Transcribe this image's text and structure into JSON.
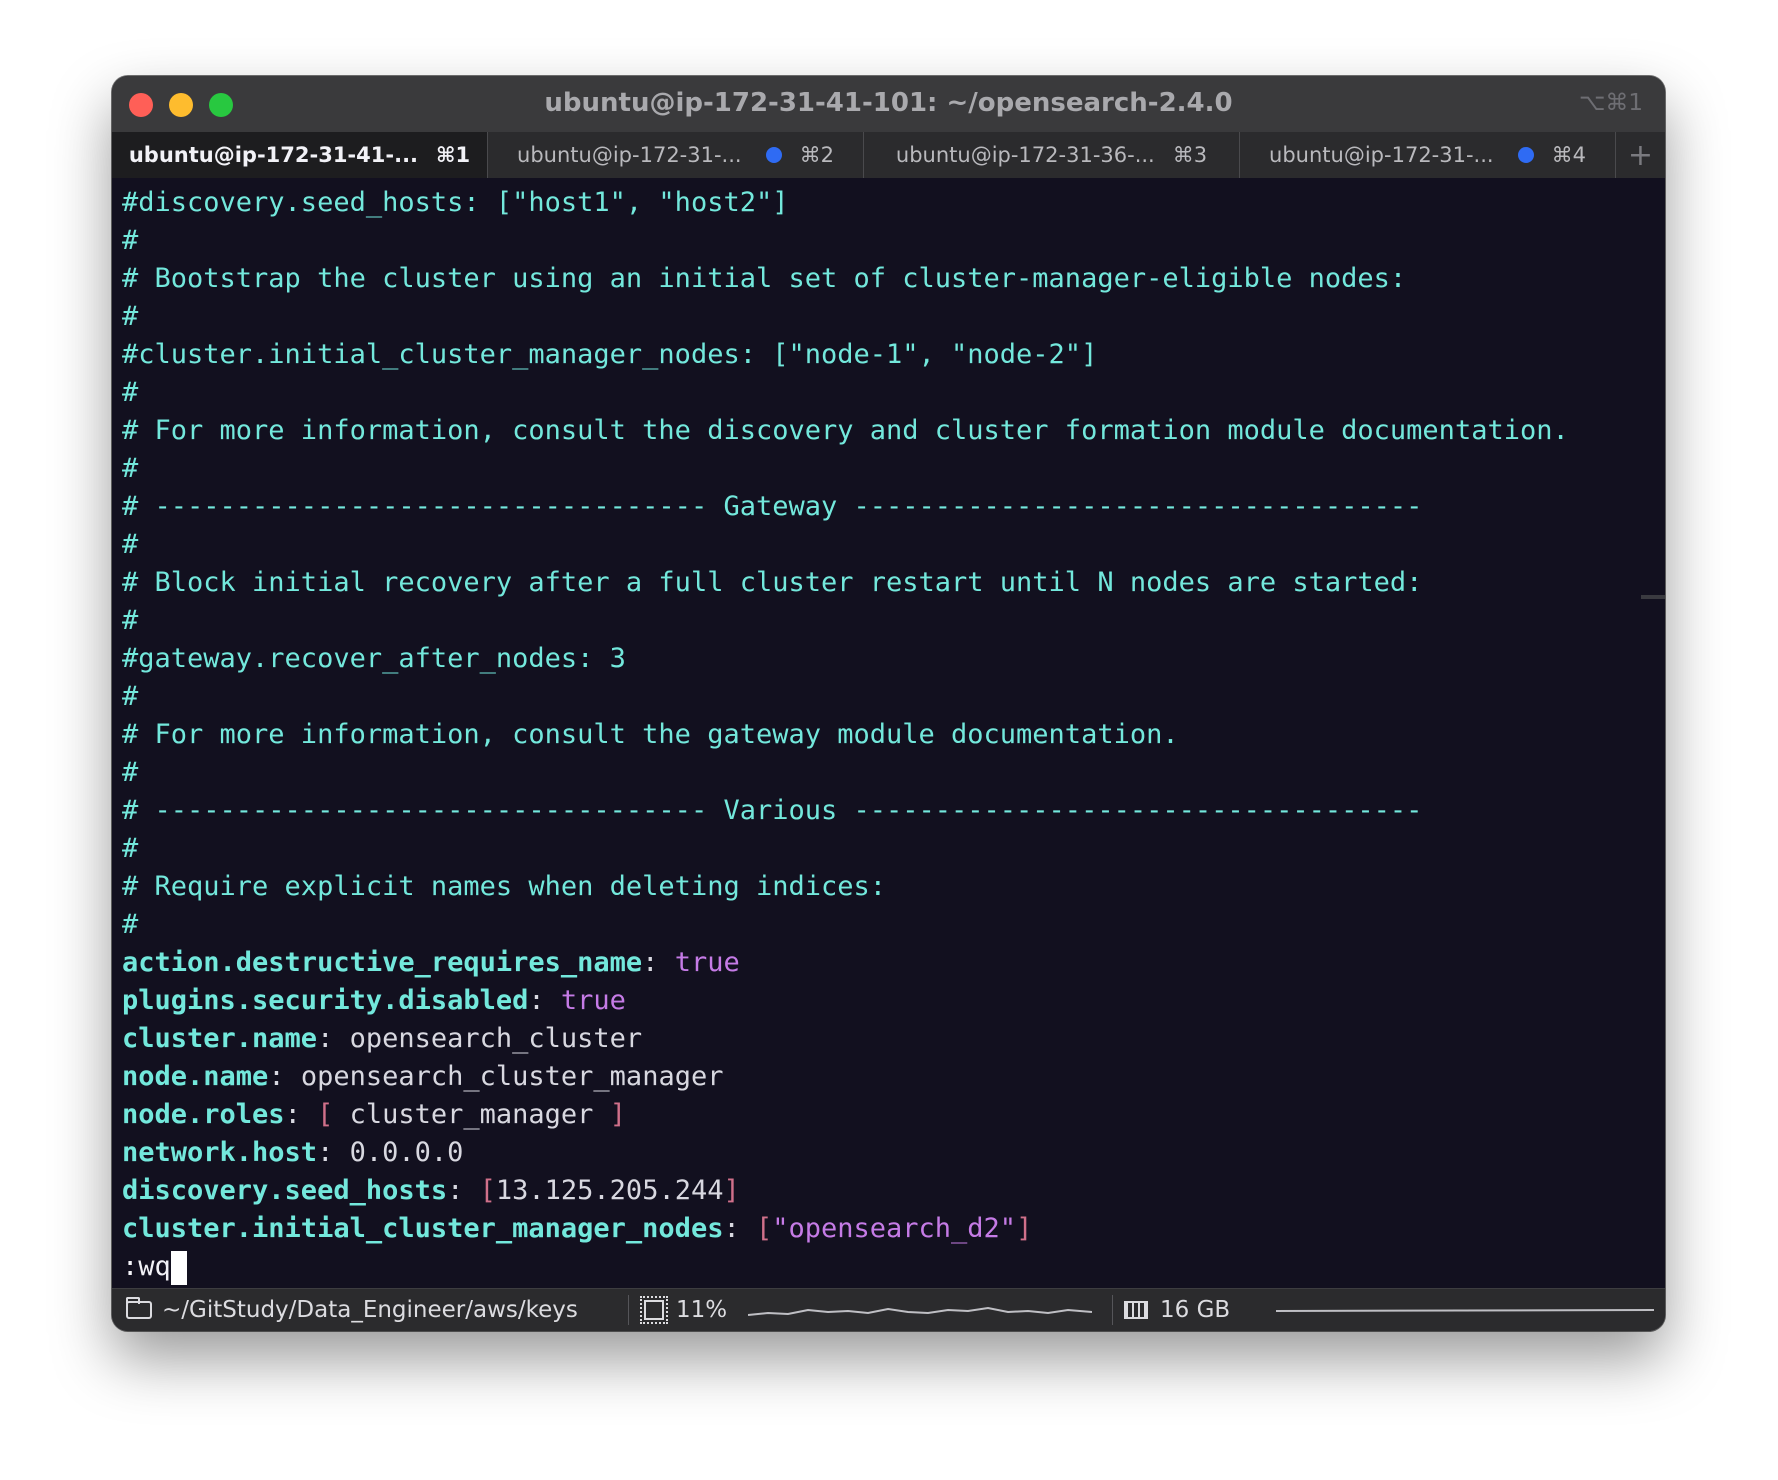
{
  "window": {
    "title": "ubuntu@ip-172-31-41-101: ~/opensearch-2.4.0",
    "title_shortcut": "⌥⌘1"
  },
  "tabs": [
    {
      "label": "ubuntu@ip-172-31-41-...",
      "shortcut": "⌘1",
      "active": true,
      "has_dot": false
    },
    {
      "label": "ubuntu@ip-172-31-...",
      "shortcut": "⌘2",
      "active": false,
      "has_dot": true
    },
    {
      "label": "ubuntu@ip-172-31-36-...",
      "shortcut": "⌘3",
      "active": false,
      "has_dot": false
    },
    {
      "label": "ubuntu@ip-172-31-...",
      "shortcut": "⌘4",
      "active": false,
      "has_dot": true
    }
  ],
  "new_tab_label": "+",
  "comments": [
    "#discovery.seed_hosts: [\"host1\", \"host2\"]",
    "#",
    "# Bootstrap the cluster using an initial set of cluster-manager-eligible nodes:",
    "#",
    "#cluster.initial_cluster_manager_nodes: [\"node-1\", \"node-2\"]",
    "#",
    "# For more information, consult the discovery and cluster formation module documentation.",
    "#",
    "# ---------------------------------- Gateway -----------------------------------",
    "#",
    "# Block initial recovery after a full cluster restart until N nodes are started:",
    "#",
    "#gateway.recover_after_nodes: 3",
    "#",
    "# For more information, consult the gateway module documentation.",
    "#",
    "# ---------------------------------- Various -----------------------------------",
    "#",
    "# Require explicit names when deleting indices:",
    "#"
  ],
  "settings": [
    {
      "key": "action.destructive_requires_name",
      "value": "true",
      "kind": "bool"
    },
    {
      "key": "plugins.security.disabled",
      "value": "true",
      "kind": "bool"
    },
    {
      "key": "cluster.name",
      "value": "opensearch_cluster",
      "kind": "plain"
    },
    {
      "key": "node.name",
      "value": "opensearch_cluster_manager",
      "kind": "plain"
    },
    {
      "key": "node.roles",
      "value": " cluster_manager ",
      "kind": "list"
    },
    {
      "key": "network.host",
      "value": "0.0.0.0",
      "kind": "plain"
    },
    {
      "key": "discovery.seed_hosts",
      "value": "13.125.205.244",
      "kind": "list"
    },
    {
      "key": "cluster.initial_cluster_manager_nodes",
      "value": "\"opensearch_d2\"",
      "kind": "liststr"
    }
  ],
  "command_line": ":wq",
  "statusbar": {
    "path": "~/GitStudy/Data_Engineer/aws/keys",
    "cpu": "11%",
    "memory": "16 GB"
  },
  "colors": {
    "comment": "#73e8dc",
    "key": "#73e8dc",
    "bool": "#c57be6",
    "bracket": "#d0708a",
    "background": "#12101f"
  }
}
